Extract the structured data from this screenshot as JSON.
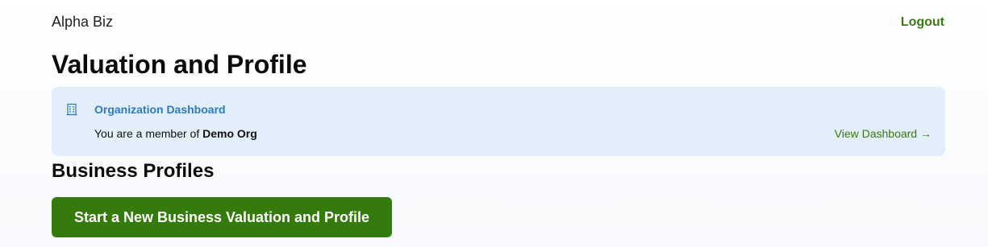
{
  "header": {
    "brand": "Alpha Biz",
    "logout_label": "Logout"
  },
  "page": {
    "title": "Valuation and Profile"
  },
  "org_card": {
    "icon": "building-icon",
    "title": "Organization Dashboard",
    "member_prefix": "You are a member of ",
    "org_name": "Demo Org",
    "view_label": "View Dashboard →"
  },
  "business_profiles": {
    "heading": "Business Profiles",
    "start_button_label": "Start a New Business Valuation and Profile"
  },
  "colors": {
    "accent_green": "#357a0c",
    "link_blue": "#2b7bc3",
    "card_bg": "#e2eef9"
  }
}
